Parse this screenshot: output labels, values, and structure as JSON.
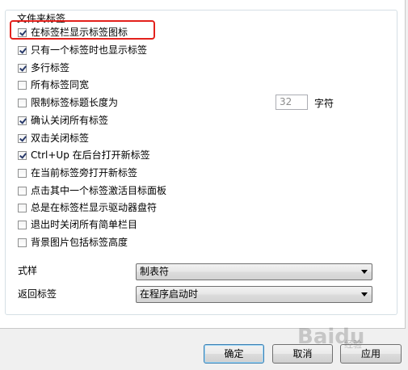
{
  "group": {
    "title": "文件夹标签"
  },
  "options": [
    {
      "label": "在标签栏显示标签图标",
      "checked": true
    },
    {
      "label": "只有一个标签时也显示标签",
      "checked": true
    },
    {
      "label": "多行标签",
      "checked": true
    },
    {
      "label": "所有标签同宽",
      "checked": false
    },
    {
      "label": "限制标签标题长度为",
      "checked": false
    },
    {
      "label": "确认关闭所有标签",
      "checked": true
    },
    {
      "label": "双击关闭标签",
      "checked": true
    },
    {
      "label": "Ctrl+Up 在后台打开新标签",
      "checked": true
    },
    {
      "label": "在当前标签旁打开新标签",
      "checked": false
    },
    {
      "label": "点击其中一个标签激活目标面板",
      "checked": false
    },
    {
      "label": "总是在标签栏显示驱动器盘符",
      "checked": false
    },
    {
      "label": "退出时关闭所有简单栏目",
      "checked": false
    },
    {
      "label": "背景图片包括标签高度",
      "checked": false
    }
  ],
  "title_length": {
    "value": "32",
    "unit": "字符"
  },
  "style_row": {
    "label": "式样",
    "value": "制表符"
  },
  "return_row": {
    "label": "返回标签",
    "value": "在程序启动时"
  },
  "buttons": {
    "ok": "确定",
    "cancel": "取消",
    "apply": "应用"
  },
  "watermark": {
    "main": "Baidu",
    "sub": "经验"
  }
}
